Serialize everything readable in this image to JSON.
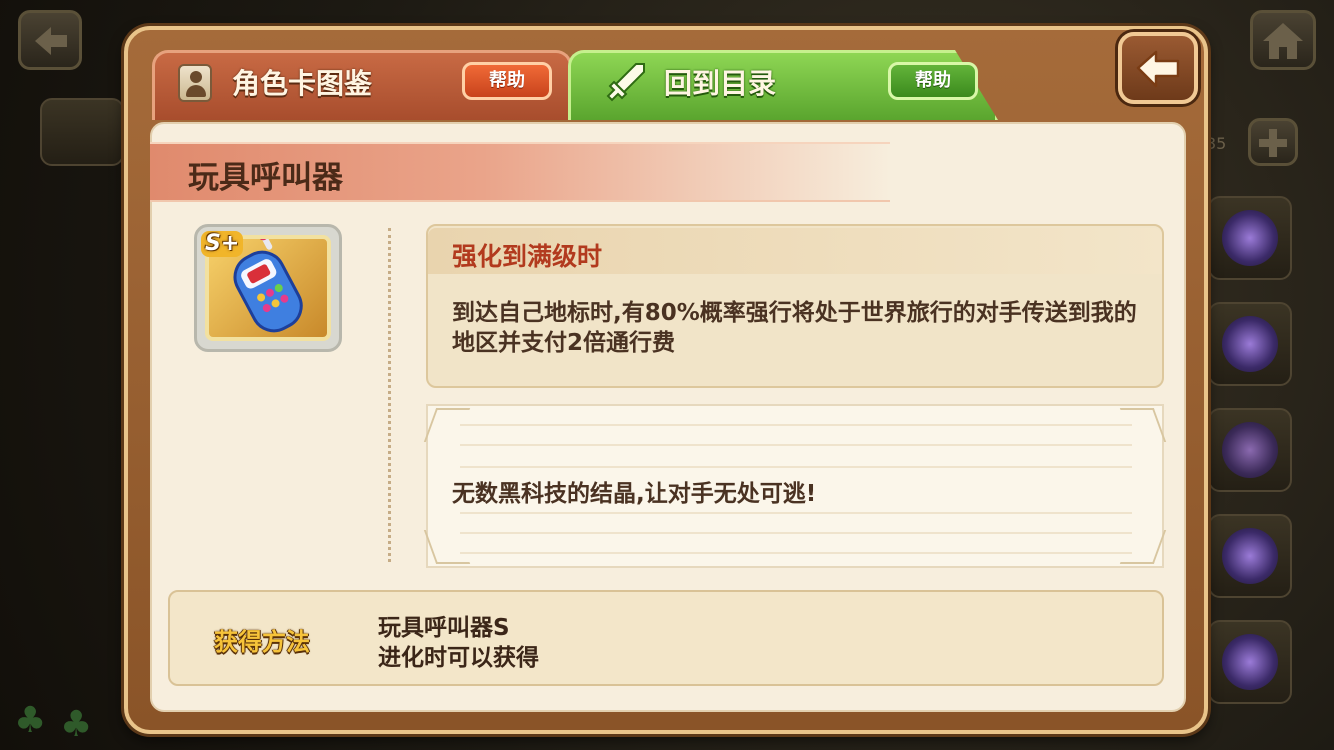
{
  "background": {
    "side_counter": "35"
  },
  "tabs": {
    "left_label": "角色卡图鉴",
    "left_help": "帮助",
    "right_label": "回到目录",
    "right_help": "帮助"
  },
  "card": {
    "title": "玩具呼叫器",
    "rank_badge": "S+",
    "icon": "toy-phone-icon"
  },
  "skill": {
    "header": "强化到满级时",
    "description": "到达自己地标时,有80%概率强行将处于世界旅行的对手传送到我的地区并支付2倍通行费"
  },
  "flavor": {
    "text": "无数黑科技的结晶,让对手无处可逃!"
  },
  "acquire": {
    "label": "获得方法",
    "line1": "玩具呼叫器S",
    "line2": "进化时可以获得"
  },
  "colors": {
    "accent_red": "#c8431c",
    "accent_green": "#5aa52e",
    "panel_bg": "#f7eedd"
  }
}
